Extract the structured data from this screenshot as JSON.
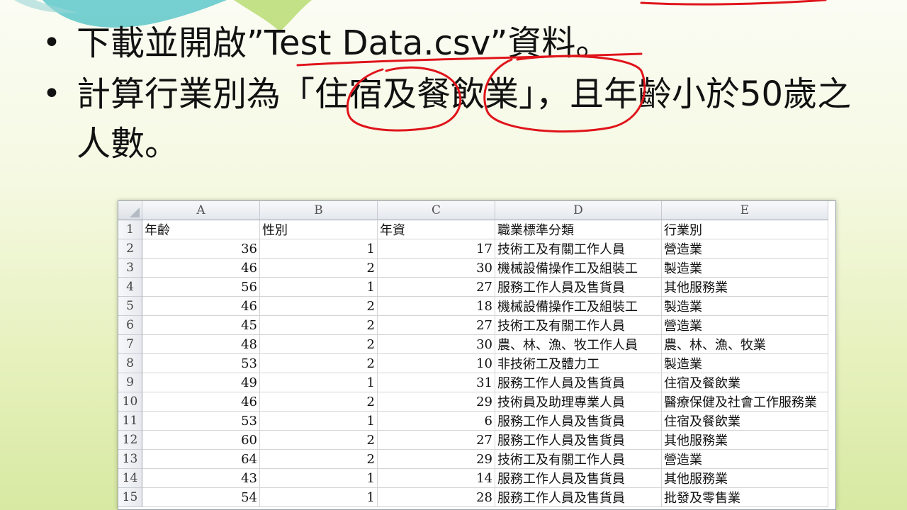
{
  "bullets": [
    "下載並開啟”Test Data.csv”資料。",
    "計算行業別為「住宿及餐飲業」，且年齡小於50歲之人數。"
  ],
  "colors": {
    "ink": "#e0141b",
    "deco_teal": "#5ec7c9",
    "deco_green": "#b5d96a"
  },
  "sheet": {
    "columns": [
      "A",
      "B",
      "C",
      "D",
      "E"
    ],
    "headers": [
      "年齡",
      "性別",
      "年資",
      "職業標準分類",
      "行業別"
    ],
    "rows": [
      [
        "36",
        "1",
        "17",
        "技術工及有關工作人員",
        "營造業"
      ],
      [
        "46",
        "2",
        "30",
        "機械設備操作工及組裝工",
        "製造業"
      ],
      [
        "56",
        "1",
        "27",
        "服務工作人員及售貨員",
        "其他服務業"
      ],
      [
        "46",
        "2",
        "18",
        "機械設備操作工及組裝工",
        "製造業"
      ],
      [
        "45",
        "2",
        "27",
        "技術工及有關工作人員",
        "營造業"
      ],
      [
        "48",
        "2",
        "30",
        "農、林、漁、牧工作人員",
        "農、林、漁、牧業"
      ],
      [
        "53",
        "2",
        "10",
        "非技術工及體力工",
        "製造業"
      ],
      [
        "49",
        "1",
        "31",
        "服務工作人員及售貨員",
        "住宿及餐飲業"
      ],
      [
        "46",
        "2",
        "29",
        "技術員及助理專業人員",
        "醫療保健及社會工作服務業"
      ],
      [
        "53",
        "1",
        "6",
        "服務工作人員及售貨員",
        "住宿及餐飲業"
      ],
      [
        "60",
        "2",
        "27",
        "服務工作人員及售貨員",
        "其他服務業"
      ],
      [
        "64",
        "2",
        "29",
        "技術工及有關工作人員",
        "營造業"
      ],
      [
        "43",
        "1",
        "14",
        "服務工作人員及售貨員",
        "其他服務業"
      ],
      [
        "54",
        "1",
        "28",
        "服務工作人員及售貨員",
        "批發及零售業"
      ]
    ]
  }
}
